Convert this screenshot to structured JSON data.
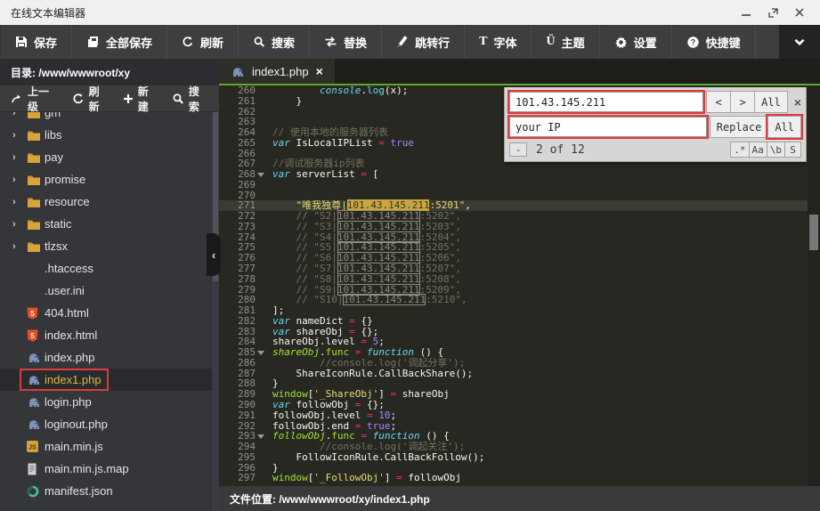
{
  "colors": {
    "accent_green": "#5fa82e",
    "annotation_red": "#dd3b3d",
    "selected_file_text": "#e3b73c",
    "editor_bg": "#272822"
  },
  "window": {
    "title": "在线文本编辑器"
  },
  "toolbar": {
    "buttons": [
      {
        "label": "保存",
        "icon": "save"
      },
      {
        "label": "全部保存",
        "icon": "save-all"
      },
      {
        "label": "刷新",
        "icon": "refresh"
      },
      {
        "label": "搜索",
        "icon": "search"
      },
      {
        "label": "替换",
        "icon": "replace"
      },
      {
        "label": "跳转行",
        "icon": "goto-line"
      },
      {
        "label": "字体",
        "icon": "font"
      },
      {
        "label": "主题",
        "icon": "theme"
      },
      {
        "label": "设置",
        "icon": "settings"
      },
      {
        "label": "快捷键",
        "icon": "shortcuts"
      }
    ]
  },
  "sidebar": {
    "dir_label": "目录: /www/wwwroot/xy",
    "toolbar": [
      {
        "label": "上一级",
        "icon": "up-level"
      },
      {
        "label": "刷新",
        "icon": "refresh"
      },
      {
        "label": "新建",
        "icon": "new"
      },
      {
        "label": "搜索",
        "icon": "search"
      }
    ],
    "tree": [
      {
        "name": "gm",
        "type": "folder"
      },
      {
        "name": "libs",
        "type": "folder"
      },
      {
        "name": "pay",
        "type": "folder"
      },
      {
        "name": "promise",
        "type": "folder"
      },
      {
        "name": "resource",
        "type": "folder"
      },
      {
        "name": "static",
        "type": "folder"
      },
      {
        "name": "tlzsx",
        "type": "folder"
      },
      {
        "name": ".htaccess",
        "type": "plain"
      },
      {
        "name": ".user.ini",
        "type": "plain"
      },
      {
        "name": "404.html",
        "type": "html"
      },
      {
        "name": "index.html",
        "type": "html"
      },
      {
        "name": "index.php",
        "type": "php"
      },
      {
        "name": "index1.php",
        "type": "php",
        "selected": true,
        "annotated": true
      },
      {
        "name": "login.php",
        "type": "php"
      },
      {
        "name": "loginout.php",
        "type": "php"
      },
      {
        "name": "main.min.js",
        "type": "js"
      },
      {
        "name": "main.min.js.map",
        "type": "map"
      },
      {
        "name": "manifest.json",
        "type": "json"
      }
    ]
  },
  "tabs": [
    {
      "label": "index1.php",
      "icon": "php",
      "close_label": "×",
      "active": true
    }
  ],
  "search_panel": {
    "find_value": "101.43.145.211",
    "replace_value": "your IP",
    "prev_label": "<",
    "next_label": ">",
    "find_all_label": "All",
    "close_label": "×",
    "replace_label": "Replace",
    "replace_all_label": "All",
    "collapse_label": "-",
    "counter": "2 of 12",
    "options": [
      ".*",
      "Aa",
      "\\b",
      "S"
    ]
  },
  "editor": {
    "first_line": 260,
    "active_line": 271,
    "fold_lines": [
      268,
      285,
      293
    ],
    "lines": [
      {
        "n": 260,
        "t": [
          [
            "p",
            "        "
          ],
          [
            "k",
            "console"
          ],
          [
            "p",
            "."
          ],
          [
            "k2",
            "log"
          ],
          [
            "p",
            "(x);"
          ]
        ]
      },
      {
        "n": 261,
        "t": [
          [
            "p",
            "    }"
          ]
        ]
      },
      {
        "n": 262,
        "t": []
      },
      {
        "n": 263,
        "t": []
      },
      {
        "n": 264,
        "t": [
          [
            "c",
            "// 使用本地的服务器列表"
          ]
        ]
      },
      {
        "n": 265,
        "t": [
          [
            "k",
            "var"
          ],
          [
            "p",
            " IsLocalIPList "
          ],
          [
            "o",
            "="
          ],
          [
            "p",
            " "
          ],
          [
            "n",
            "true"
          ]
        ]
      },
      {
        "n": 266,
        "t": []
      },
      {
        "n": 267,
        "t": [
          [
            "c",
            "//调试服务器ip列表"
          ]
        ]
      },
      {
        "n": 268,
        "fold": true,
        "t": [
          [
            "k",
            "var"
          ],
          [
            "p",
            " serverList "
          ],
          [
            "o",
            "="
          ],
          [
            "p",
            " ["
          ]
        ]
      },
      {
        "n": 269,
        "t": []
      },
      {
        "n": 270,
        "t": []
      },
      {
        "n": 271,
        "active": true,
        "t": [
          [
            "p",
            "    "
          ],
          [
            "s",
            "\"唯我独尊|"
          ],
          [
            "ms",
            "101.43.145.211"
          ],
          [
            "s",
            ":5201\""
          ],
          [
            "p",
            ","
          ]
        ]
      },
      {
        "n": 272,
        "t": [
          [
            "c",
            "    // \"S2|"
          ],
          [
            "m",
            "101.43.145.211"
          ],
          [
            "c",
            ":5202\","
          ]
        ]
      },
      {
        "n": 273,
        "t": [
          [
            "c",
            "    // \"S3|"
          ],
          [
            "m",
            "101.43.145.211"
          ],
          [
            "c",
            ":5203\","
          ]
        ]
      },
      {
        "n": 274,
        "t": [
          [
            "c",
            "    // \"S4|"
          ],
          [
            "m",
            "101.43.145.211"
          ],
          [
            "c",
            ":5204\","
          ]
        ]
      },
      {
        "n": 275,
        "t": [
          [
            "c",
            "    // \"S5|"
          ],
          [
            "m",
            "101.43.145.211"
          ],
          [
            "c",
            ":5205\","
          ]
        ]
      },
      {
        "n": 276,
        "t": [
          [
            "c",
            "    // \"S6|"
          ],
          [
            "m",
            "101.43.145.211"
          ],
          [
            "c",
            ":5206\","
          ]
        ]
      },
      {
        "n": 277,
        "t": [
          [
            "c",
            "    // \"S7|"
          ],
          [
            "m",
            "101.43.145.211"
          ],
          [
            "c",
            ":5207\","
          ]
        ]
      },
      {
        "n": 278,
        "t": [
          [
            "c",
            "    // \"S8|"
          ],
          [
            "m",
            "101.43.145.211"
          ],
          [
            "c",
            ":5208\","
          ]
        ]
      },
      {
        "n": 279,
        "t": [
          [
            "c",
            "    // \"S9|"
          ],
          [
            "m",
            "101.43.145.211"
          ],
          [
            "c",
            ":5209\","
          ]
        ]
      },
      {
        "n": 280,
        "t": [
          [
            "c",
            "    // \"S10|"
          ],
          [
            "m",
            "101.43.145.211"
          ],
          [
            "c",
            ":5210\","
          ]
        ]
      },
      {
        "n": 281,
        "t": [
          [
            "p",
            "];"
          ]
        ]
      },
      {
        "n": 282,
        "t": [
          [
            "k",
            "var"
          ],
          [
            "p",
            " nameDict "
          ],
          [
            "o",
            "="
          ],
          [
            "p",
            " {}"
          ]
        ]
      },
      {
        "n": 283,
        "t": [
          [
            "k",
            "var"
          ],
          [
            "p",
            " shareObj "
          ],
          [
            "o",
            "="
          ],
          [
            "p",
            " {};"
          ]
        ]
      },
      {
        "n": 284,
        "t": [
          [
            "p",
            "shareObj.level "
          ],
          [
            "o",
            "="
          ],
          [
            "p",
            " "
          ],
          [
            "n",
            "5"
          ],
          [
            "p",
            ";"
          ]
        ]
      },
      {
        "n": 285,
        "fold": true,
        "t": [
          [
            "fi",
            "shareObj"
          ],
          [
            "p",
            "."
          ],
          [
            "f",
            "func"
          ],
          [
            "p",
            " "
          ],
          [
            "o",
            "="
          ],
          [
            "p",
            " "
          ],
          [
            "k",
            "function"
          ],
          [
            "p",
            " () {"
          ]
        ]
      },
      {
        "n": 286,
        "t": [
          [
            "c",
            "        //console.log('调起分享');"
          ]
        ]
      },
      {
        "n": 287,
        "t": [
          [
            "p",
            "    ShareIconRule.CallBackShare();"
          ]
        ]
      },
      {
        "n": 288,
        "t": [
          [
            "p",
            "}"
          ]
        ]
      },
      {
        "n": 289,
        "t": [
          [
            "f",
            "window"
          ],
          [
            "p",
            "["
          ],
          [
            "s",
            "'_ShareObj'"
          ],
          [
            "p",
            "] "
          ],
          [
            "o",
            "="
          ],
          [
            "p",
            " shareObj"
          ]
        ]
      },
      {
        "n": 290,
        "t": [
          [
            "k",
            "var"
          ],
          [
            "p",
            " followObj "
          ],
          [
            "o",
            "="
          ],
          [
            "p",
            " {};"
          ]
        ]
      },
      {
        "n": 291,
        "t": [
          [
            "p",
            "followObj.level "
          ],
          [
            "o",
            "="
          ],
          [
            "p",
            " "
          ],
          [
            "n",
            "10"
          ],
          [
            "p",
            ";"
          ]
        ]
      },
      {
        "n": 292,
        "t": [
          [
            "p",
            "followObj.end "
          ],
          [
            "o",
            "="
          ],
          [
            "p",
            " "
          ],
          [
            "n",
            "true"
          ],
          [
            "p",
            ";"
          ]
        ]
      },
      {
        "n": 293,
        "fold": true,
        "t": [
          [
            "fi",
            "followObj"
          ],
          [
            "p",
            "."
          ],
          [
            "f",
            "func"
          ],
          [
            "p",
            " "
          ],
          [
            "o",
            "="
          ],
          [
            "p",
            " "
          ],
          [
            "k",
            "function"
          ],
          [
            "p",
            " () {"
          ]
        ]
      },
      {
        "n": 294,
        "t": [
          [
            "c",
            "        //console.log('调起关注');"
          ]
        ]
      },
      {
        "n": 295,
        "t": [
          [
            "p",
            "    FollowIconRule.CallBackFollow();"
          ]
        ]
      },
      {
        "n": 296,
        "t": [
          [
            "p",
            "}"
          ]
        ]
      },
      {
        "n": 297,
        "t": [
          [
            "f",
            "window"
          ],
          [
            "p",
            "["
          ],
          [
            "s",
            "'_FollowObj'"
          ],
          [
            "p",
            "] "
          ],
          [
            "o",
            "="
          ],
          [
            "p",
            " followObj"
          ]
        ]
      }
    ]
  },
  "status_bar": {
    "text": "文件位置: /www/wwwroot/xy/index1.php"
  }
}
